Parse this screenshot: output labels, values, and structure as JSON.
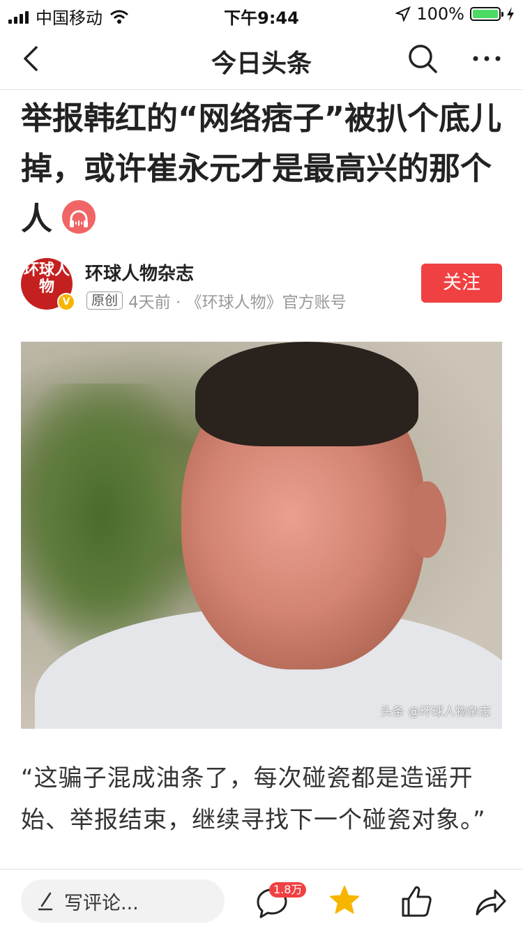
{
  "status_bar": {
    "carrier": "中国移动",
    "time": "下午9:44",
    "battery": "100%"
  },
  "nav": {
    "title": "今日头条",
    "back_icon": "chevron-left-icon",
    "search_icon": "search-icon",
    "more_icon": "more-icon"
  },
  "article": {
    "headline": "举报韩红的“网络痞子”被扒个底儿掉，或许崔永元才是最高兴的那个人",
    "author": {
      "name": "环球人物杂志",
      "avatar_text": "环球人物",
      "original_tag": "原创",
      "meta": "4天前 · 《环球人物》官方账号",
      "follow_label": "关注"
    },
    "image_watermark": "头条 @环球人物杂志",
    "body": "“这骗子混成油条了，每次碰瓷都是造谣开始、举报结束，继续寻找下一个碰瓷对象。”"
  },
  "bottom_bar": {
    "comment_placeholder": "写评论...",
    "comment_count": "1.8万"
  },
  "colors": {
    "accent": "#f04142",
    "audio": "#f16566",
    "star": "#f7b500",
    "battery": "#4cd964"
  }
}
